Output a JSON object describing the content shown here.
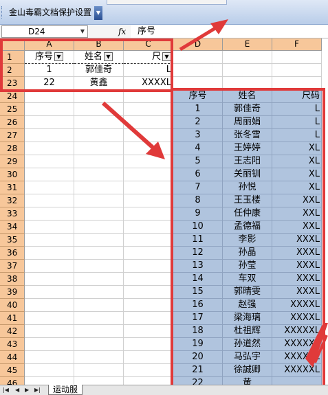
{
  "toolbar": {
    "button_label": "金山毒霸文档保护设置"
  },
  "formula_bar": {
    "name_box": "D24",
    "fx_label": "fx",
    "content": "序号"
  },
  "grid": {
    "columns": [
      "A",
      "B",
      "C",
      "D",
      "E",
      "F"
    ],
    "filter_header_row": {
      "row": "1",
      "A": "序号",
      "B": "姓名",
      "C": "尺"
    },
    "filtered_rows": [
      {
        "row": "2",
        "A": "1",
        "B": "郭佳奇",
        "C": "L"
      },
      {
        "row": "23",
        "A": "22",
        "B": "黄鑫",
        "C": "XXXXL"
      }
    ],
    "pasted_header": {
      "row": "24",
      "D": "序号",
      "E": "姓名",
      "F": "尺码"
    },
    "pasted_rows": [
      {
        "row": "25",
        "D": "1",
        "E": "郭佳奇",
        "F": "L"
      },
      {
        "row": "26",
        "D": "2",
        "E": "周丽娟",
        "F": "L"
      },
      {
        "row": "27",
        "D": "3",
        "E": "张冬雪",
        "F": "L"
      },
      {
        "row": "28",
        "D": "4",
        "E": "王婷婷",
        "F": "XL"
      },
      {
        "row": "29",
        "D": "5",
        "E": "王志阳",
        "F": "XL"
      },
      {
        "row": "30",
        "D": "6",
        "E": "关丽钏",
        "F": "XL"
      },
      {
        "row": "31",
        "D": "7",
        "E": "孙悦",
        "F": "XL"
      },
      {
        "row": "32",
        "D": "8",
        "E": "王玉楼",
        "F": "XXL"
      },
      {
        "row": "33",
        "D": "9",
        "E": "任仲康",
        "F": "XXL"
      },
      {
        "row": "34",
        "D": "10",
        "E": "孟德福",
        "F": "XXL"
      },
      {
        "row": "35",
        "D": "11",
        "E": "李影",
        "F": "XXXL"
      },
      {
        "row": "36",
        "D": "12",
        "E": "孙晶",
        "F": "XXXL"
      },
      {
        "row": "37",
        "D": "13",
        "E": "孙莹",
        "F": "XXXL"
      },
      {
        "row": "38",
        "D": "14",
        "E": "车双",
        "F": "XXXL"
      },
      {
        "row": "39",
        "D": "15",
        "E": "郭晴雯",
        "F": "XXXL"
      },
      {
        "row": "40",
        "D": "16",
        "E": "赵强",
        "F": "XXXXL"
      },
      {
        "row": "41",
        "D": "17",
        "E": "梁海璃",
        "F": "XXXXL"
      },
      {
        "row": "42",
        "D": "18",
        "E": "杜祖辉",
        "F": "XXXXXL"
      },
      {
        "row": "43",
        "D": "19",
        "E": "孙道然",
        "F": "XXXXXL"
      },
      {
        "row": "44",
        "D": "20",
        "E": "马弘宇",
        "F": "XXXXXL"
      },
      {
        "row": "45",
        "D": "21",
        "E": "徐誠卿",
        "F": "XXXXXL"
      },
      {
        "row": "46",
        "D": "22",
        "E": "黄",
        "F": ""
      }
    ]
  },
  "sheet_tabs": {
    "nav": [
      "|◀",
      "◀",
      "▶",
      "▶|"
    ],
    "active": "运动服"
  },
  "colors": {
    "header": "#f7c79a",
    "selection": "#b0c4de",
    "annotation": "#e03a3a"
  }
}
